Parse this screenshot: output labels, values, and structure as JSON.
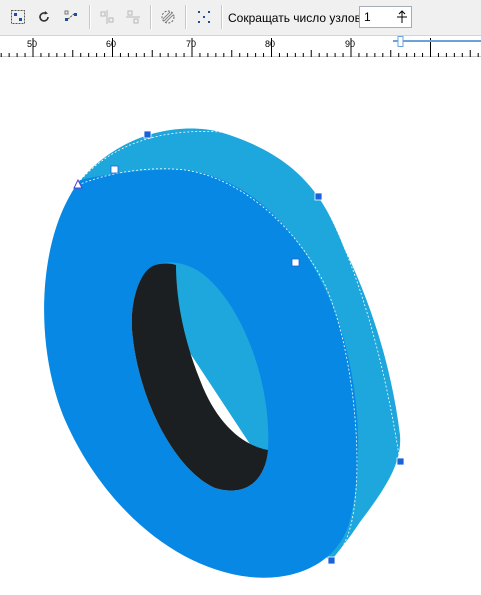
{
  "toolbar": {
    "reduce_nodes_label": "Сокращать число узлов",
    "reduce_nodes_value": "1",
    "icons": [
      "select-all-nodes-icon",
      "rotate-nodes-icon",
      "reflect-nodes-icon",
      "align-horizontal-icon",
      "align-vertical-icon",
      "elastic-mode-icon",
      "select-all-nodes-grid-icon"
    ]
  },
  "ruler": {
    "labels": [
      "50",
      "60",
      "70",
      "80",
      "90"
    ]
  },
  "colors": {
    "face": "#0688e4",
    "side": "#1ea7dc",
    "hole_shadow": "#1c1f21",
    "toolbar_bg": "#f0f0f0"
  }
}
